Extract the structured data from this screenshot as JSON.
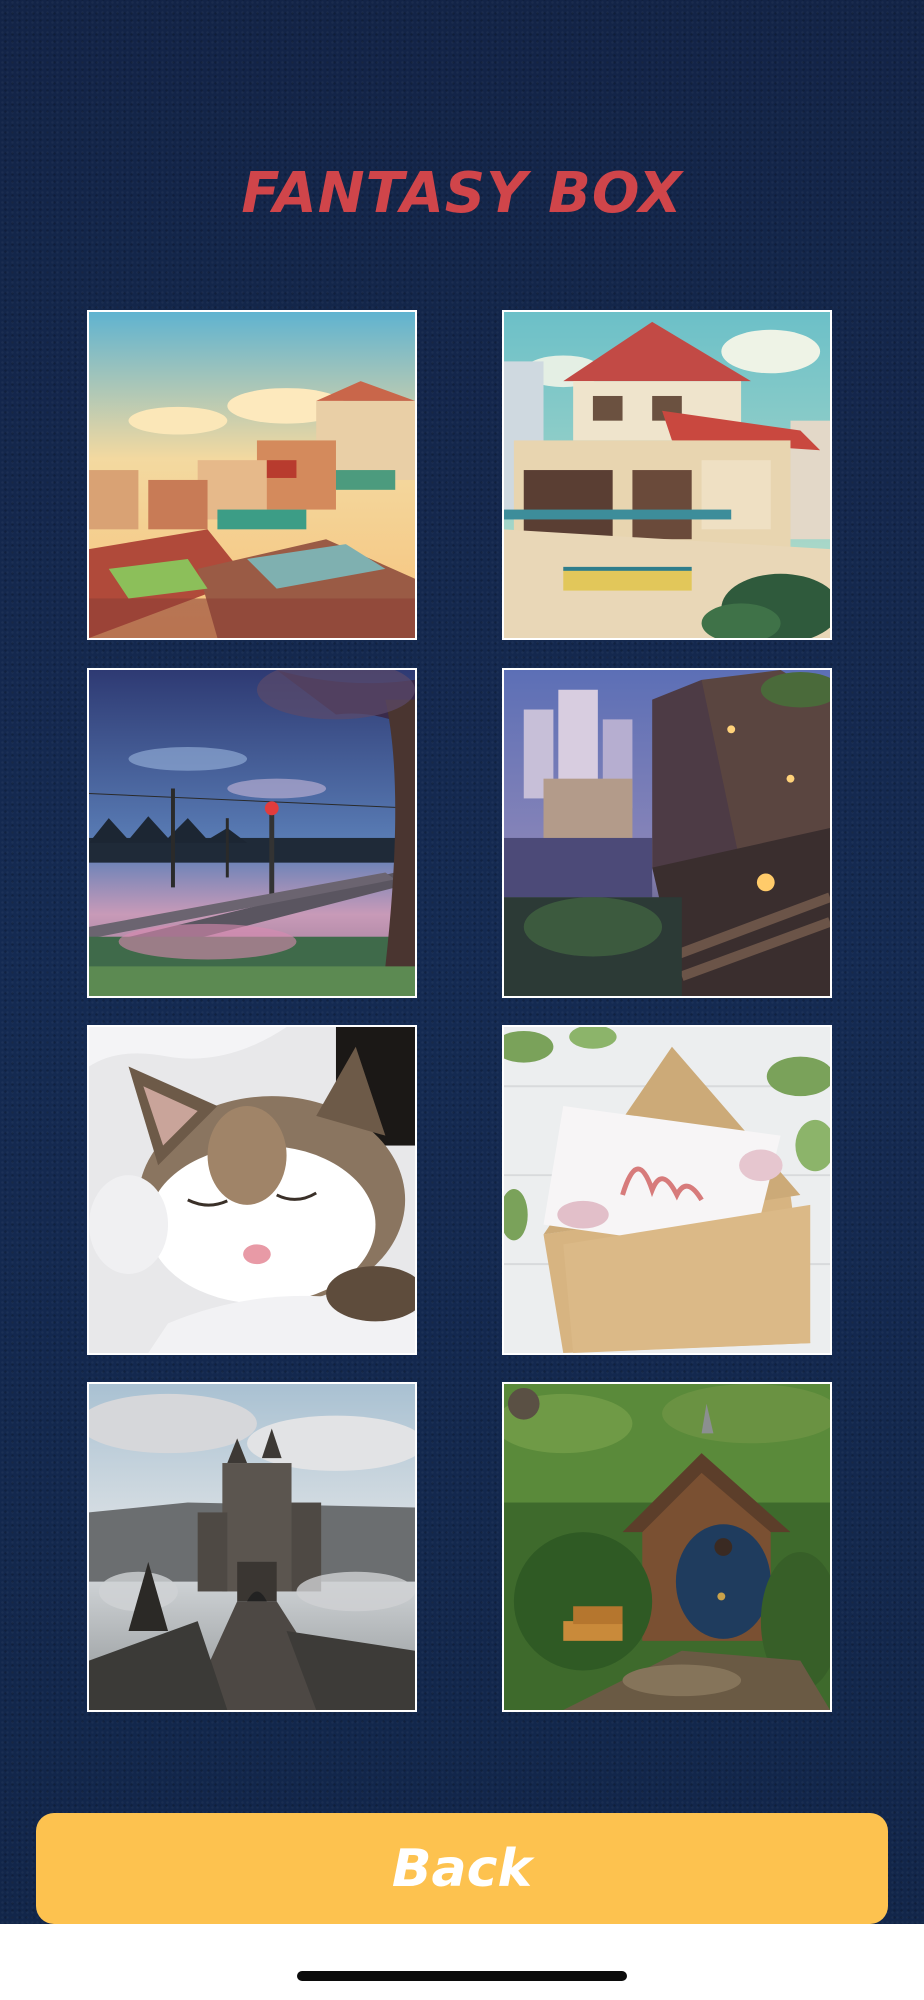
{
  "title": "FANTASY BOX",
  "title_color": "#d0454a",
  "back_button": {
    "label": "Back",
    "color": "#fdc24f"
  },
  "tiles": [
    {
      "subject": "rooftops-town-illustration"
    },
    {
      "subject": "corner-shop-house-illustration"
    },
    {
      "subject": "railway-crossing-dusk-illustration"
    },
    {
      "subject": "fantasy-city-stairs-illustration"
    },
    {
      "subject": "sleeping-cat-photo"
    },
    {
      "subject": "love-envelope-photo"
    },
    {
      "subject": "misty-castle-photo"
    },
    {
      "subject": "hobbit-house-photo"
    }
  ]
}
